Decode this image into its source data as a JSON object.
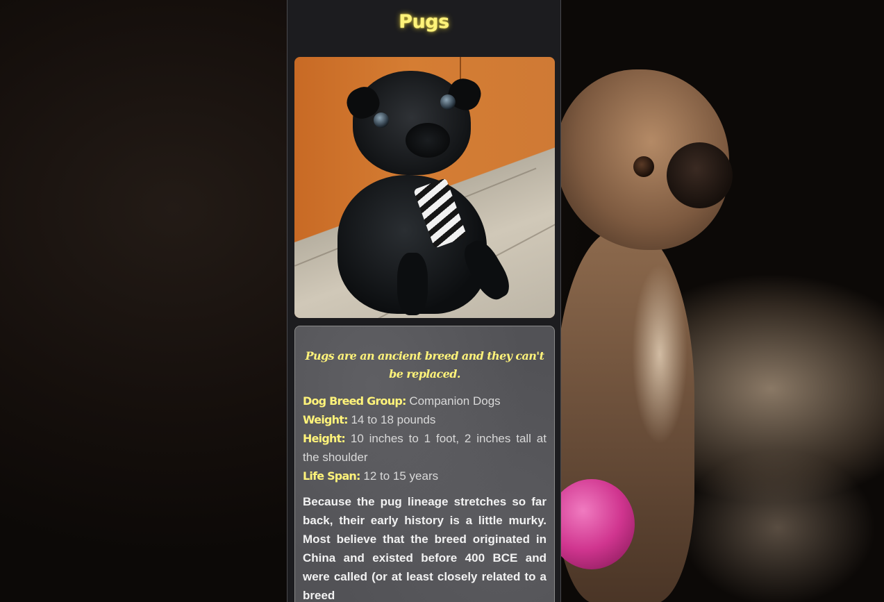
{
  "page": {
    "title": "Pugs"
  },
  "photo": {
    "subject": "black pug wearing a striped tie"
  },
  "info": {
    "tagline": "Pugs are an ancient breed and they can't be replaced.",
    "facts": [
      {
        "label": "Dog Breed Group:",
        "value": "Companion Dogs"
      },
      {
        "label": "Weight:",
        "value": "14 to 18 pounds"
      },
      {
        "label": "Height:",
        "value": "10 inches to 1 foot, 2 inches tall at the shoulder"
      },
      {
        "label": "Life Span:",
        "value": "12 to 15 years"
      }
    ],
    "history": "Because the pug lineage stretches so far back, their early history is a little murky. Most believe that the breed originated in China and existed before 400 BCE and were called (or at least closely related to a breed"
  },
  "colors": {
    "accent": "#fff37a",
    "panel": "#1c1c1f",
    "card": "#525256"
  }
}
